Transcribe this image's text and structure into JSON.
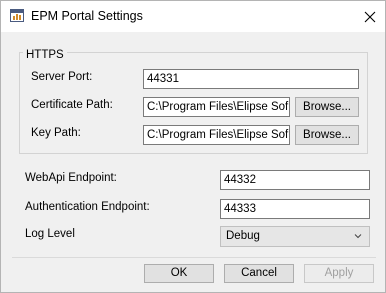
{
  "window": {
    "title": "EPM Portal Settings"
  },
  "https_group": {
    "legend": "HTTPS",
    "server_port": {
      "label": "Server Port:",
      "value": "44331"
    },
    "certificate_path": {
      "label": "Certificate Path:",
      "value": "C:\\Program Files\\Elipse Sof",
      "browse_label": "Browse..."
    },
    "key_path": {
      "label": "Key Path:",
      "value": "C:\\Program Files\\Elipse Sof",
      "browse_label": "Browse..."
    }
  },
  "webapi_endpoint": {
    "label": "WebApi Endpoint:",
    "value": "44332"
  },
  "auth_endpoint": {
    "label": "Authentication Endpoint:",
    "value": "44333"
  },
  "log_level": {
    "label": "Log Level",
    "value": "Debug"
  },
  "buttons": {
    "ok": "OK",
    "cancel": "Cancel",
    "apply": "Apply"
  }
}
